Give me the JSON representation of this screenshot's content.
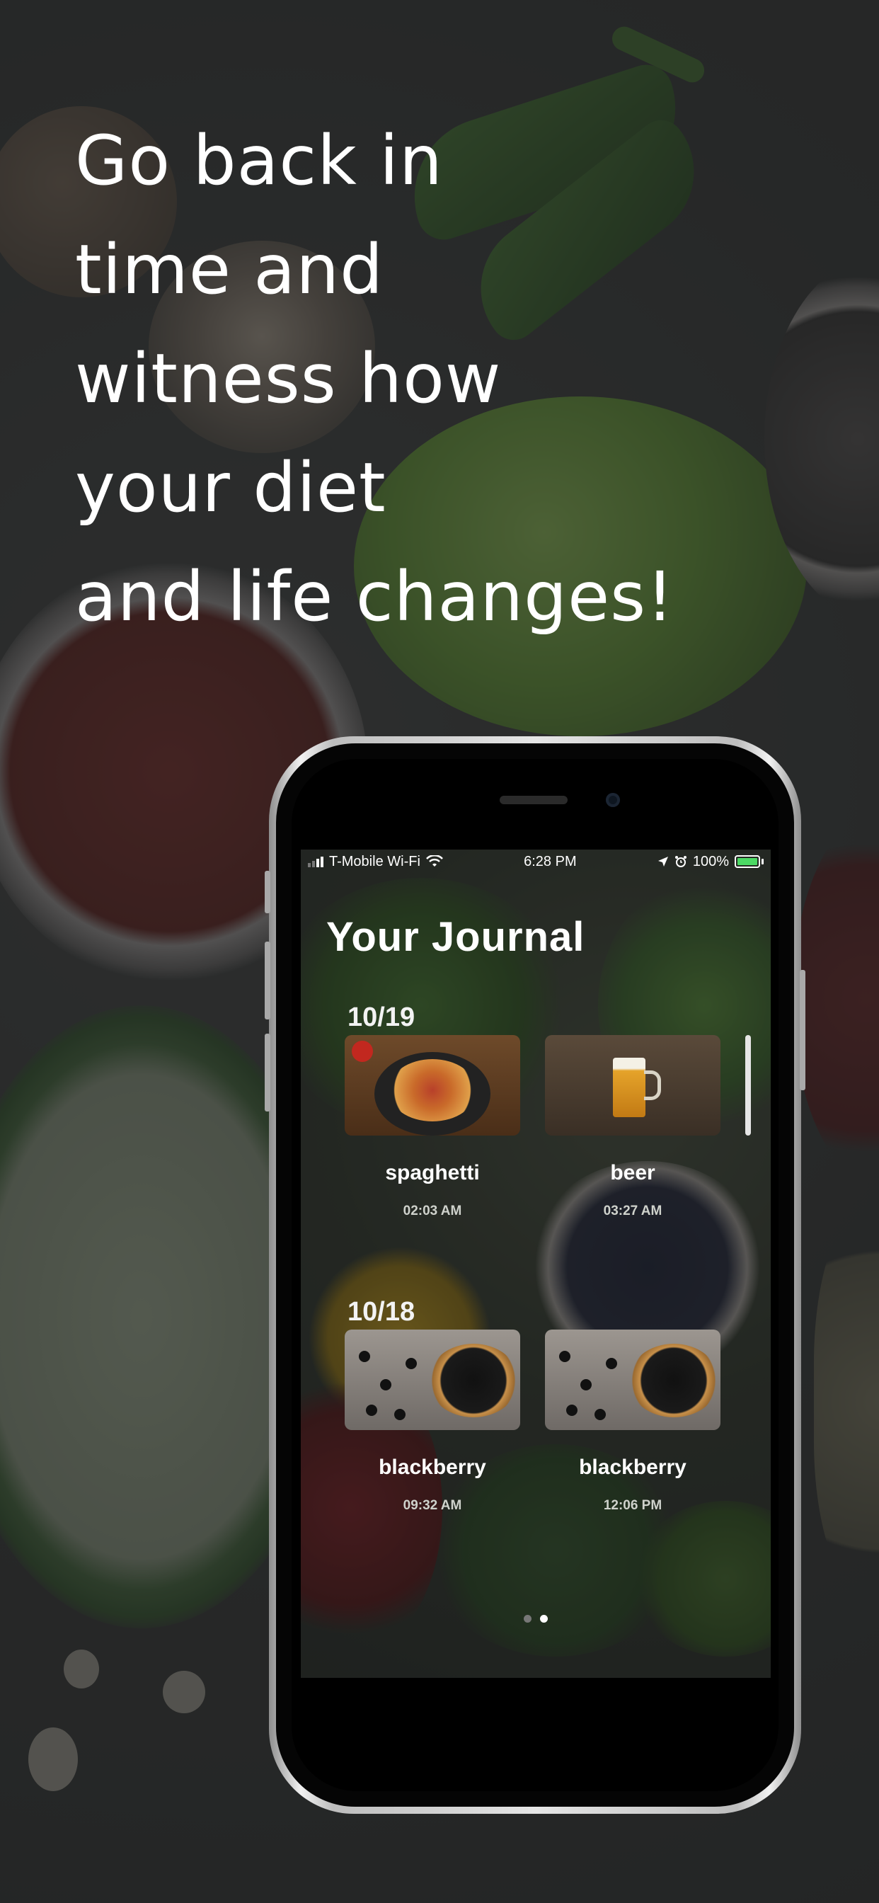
{
  "headline": {
    "line1": "Go back in",
    "line2": "time and",
    "line3": "witness how",
    "line4": "your diet",
    "line5": "and life changes!"
  },
  "status_bar": {
    "carrier": "T-Mobile Wi-Fi",
    "time": "6:28 PM",
    "battery": "100%"
  },
  "journal": {
    "title": "Your Journal",
    "groups": [
      {
        "date": "10/19",
        "entries": [
          {
            "name": "spaghetti",
            "time": "02:03 AM",
            "image": "spaghetti-photo"
          },
          {
            "name": "beer",
            "time": "03:27 AM",
            "image": "beer-photo"
          }
        ]
      },
      {
        "date": "10/18",
        "entries": [
          {
            "name": "blackberry",
            "time": "09:32 AM",
            "image": "blackberry-photo"
          },
          {
            "name": "blackberry",
            "time": "12:06 PM",
            "image": "blackberry-photo"
          }
        ]
      }
    ]
  },
  "pager": {
    "pages": 2,
    "active_page": 2
  },
  "colors": {
    "battery": "#4cd964",
    "background": "#2f3030"
  }
}
